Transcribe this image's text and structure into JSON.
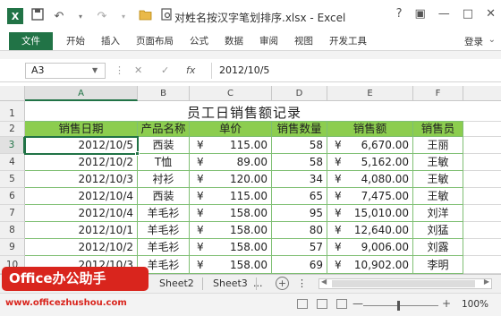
{
  "app": {
    "logo": "X",
    "title": "对姓名按汉字笔划排序.xlsx - Excel",
    "window_controls": [
      "?",
      "▣",
      "—",
      "□",
      "✕"
    ],
    "qat_icons": [
      "save-icon",
      "undo-icon",
      "redo-icon",
      "open-icon",
      "print-preview-icon"
    ]
  },
  "ribbon": {
    "tabs": [
      "文件",
      "开始",
      "插入",
      "页面布局",
      "公式",
      "数据",
      "审阅",
      "视图",
      "开发工具"
    ],
    "active_tab": "文件",
    "login": "登录"
  },
  "formula_bar": {
    "name_box": "A3",
    "fx": "fx",
    "value": "2012/10/5"
  },
  "grid": {
    "columns": [
      "A",
      "B",
      "C",
      "D",
      "E",
      "F"
    ],
    "rows": [
      "1",
      "2",
      "3",
      "4",
      "5",
      "6",
      "7",
      "8",
      "9",
      "10"
    ],
    "selected_cell": "A3",
    "title": "员工日销售额记录",
    "headers": [
      "销售日期",
      "产品名称",
      "单价",
      "销售数量",
      "销售额",
      "销售员"
    ],
    "data": [
      {
        "date": "2012/10/5",
        "product": "西装",
        "currency": "¥",
        "price": "115.00",
        "qty": "58",
        "amount": "6,670.00",
        "seller": "王丽"
      },
      {
        "date": "2012/10/2",
        "product": "T恤",
        "currency": "¥",
        "price": "89.00",
        "qty": "58",
        "amount": "5,162.00",
        "seller": "王敏"
      },
      {
        "date": "2012/10/3",
        "product": "衬衫",
        "currency": "¥",
        "price": "120.00",
        "qty": "34",
        "amount": "4,080.00",
        "seller": "王敏"
      },
      {
        "date": "2012/10/4",
        "product": "西装",
        "currency": "¥",
        "price": "115.00",
        "qty": "65",
        "amount": "7,475.00",
        "seller": "王敏"
      },
      {
        "date": "2012/10/4",
        "product": "羊毛衫",
        "currency": "¥",
        "price": "158.00",
        "qty": "95",
        "amount": "15,010.00",
        "seller": "刘洋"
      },
      {
        "date": "2012/10/1",
        "product": "羊毛衫",
        "currency": "¥",
        "price": "158.00",
        "qty": "80",
        "amount": "12,640.00",
        "seller": "刘猛"
      },
      {
        "date": "2012/10/2",
        "product": "羊毛衫",
        "currency": "¥",
        "price": "158.00",
        "qty": "57",
        "amount": "9,006.00",
        "seller": "刘露"
      },
      {
        "date": "2012/10/3",
        "product": "羊毛衫",
        "currency": "¥",
        "price": "158.00",
        "qty": "69",
        "amount": "10,902.00",
        "seller": "李明"
      }
    ]
  },
  "sheets": {
    "tabs": [
      "Sheet2",
      "Sheet3"
    ],
    "add_label": "+",
    "more_label": "..."
  },
  "status": {
    "zoom": "100%",
    "zoom_level": 1.0
  },
  "watermark": {
    "label": "Office办公助手",
    "url": "www.officezhushou.com"
  },
  "colors": {
    "excel_green": "#217346",
    "header_fill": "#8ccd4f",
    "border_green": "#7fbf73",
    "watermark_red": "#d9251d"
  }
}
